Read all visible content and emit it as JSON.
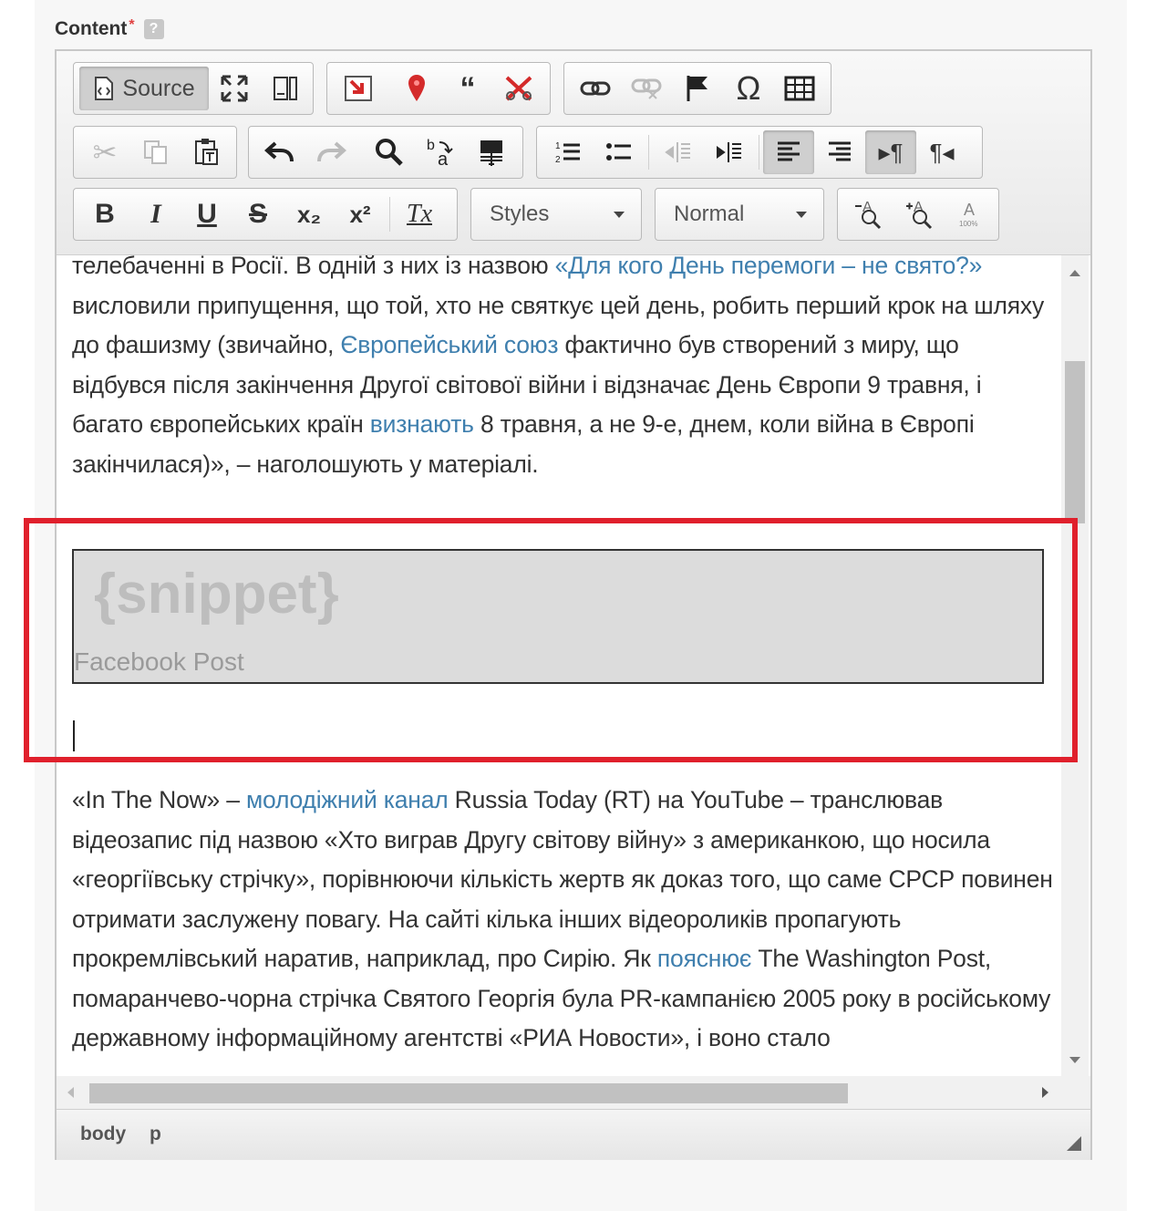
{
  "field": {
    "label": "Content",
    "required_mark": "*",
    "help_icon": "?"
  },
  "toolbar": {
    "source_label": "Source",
    "styles_label": "Styles",
    "format_label": "Normal",
    "special_char": "Ω",
    "bold": "B",
    "italic": "I",
    "underline": "U",
    "strike": "S",
    "subscript": "x₂",
    "superscript": "x²",
    "remove_format": "Tx"
  },
  "content": {
    "p1_l1": "телебаченні в Росії. В одній з них із назвою ",
    "p1_link1": "«Для кого День перемоги – не свято?»",
    "p1_l1b": " висловили припущення, що той, хто не святкує цей день, робить перший крок на шляху до фашизму (звичайно, ",
    "p1_link2": "Європейський союз",
    "p1_l2": " фактично був створений з миру, що відбувся після закінчення Другої світової війни і відзначає День Європи 9 травня, і багато європейських країн ",
    "p1_link3": "визнають",
    "p1_l3": " 8 травня, а не 9-е, днем, коли війна в Європі закінчилася)», – наголошують у матеріалі.",
    "snippet_title": "{snippet}",
    "snippet_caption": "Facebook Post",
    "p2_a": "«In The Now» – ",
    "p2_link1": "молодіжний канал",
    "p2_b": " Russia Today (RT) на YouTube – транслював відеозапис під назвою «Хто виграв Другу світову війну» з американкою, що носила «георгіївську стрічку», порівнюючи кількість жертв як доказ того, що саме СРСР повинен отримати заслужену повагу. На сайті кілька інших відеороликів пропагують прокремлівський наратив, наприклад, про Сирію. Як ",
    "p2_link2": "пояснює",
    "p2_c": " The Washington Post, помаранчево-чорна стрічка Святого Георгія була PR-кампанією 2005 року в російському державному інформаційному агентстві «РИА Новости», і воно стало"
  },
  "statusbar": {
    "path": [
      "body",
      "p"
    ]
  },
  "colors": {
    "link": "#3f7fae",
    "highlight": "#e0202c"
  }
}
